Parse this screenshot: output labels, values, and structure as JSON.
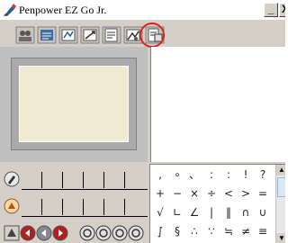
{
  "window": {
    "title": "Penpower EZ Go Jr.",
    "minimize_label": "_",
    "close_label": "X"
  },
  "toolbar": {
    "tools": [
      {
        "name": "user-settings-icon"
      },
      {
        "name": "keyboard-dictionary-icon"
      },
      {
        "name": "handwriting-mode-icon"
      },
      {
        "name": "recognition-mode-icon"
      },
      {
        "name": "document-edit-icon"
      },
      {
        "name": "image-tool-icon"
      },
      {
        "name": "scan-tool-icon",
        "highlighted": true
      }
    ],
    "highlight_color": "#e02020"
  },
  "candidates": {
    "row1_icon": "pen-candidate-icon",
    "row2_icon": "color-candidate-icon",
    "slots_per_row": 6
  },
  "nav_buttons": [
    "pen-color-icon",
    "first-page-icon",
    "prev-page-icon",
    "next-page-icon",
    "circle-1-icon",
    "circle-2-icon",
    "circle-3-icon",
    "circle-4-icon"
  ],
  "symbols": {
    "rows": [
      [
        ",",
        "∘",
        "、",
        ":",
        ":",
        "!",
        "?"
      ],
      [
        "+",
        "−",
        "×",
        "÷",
        "<",
        ">",
        "="
      ],
      [
        "√",
        "∟",
        "∠",
        "|",
        "‖",
        "∩",
        "∪"
      ],
      [
        "∫",
        "§",
        "∴",
        "∵",
        "≒",
        "≠",
        "≡"
      ]
    ]
  },
  "colors": {
    "window_bg": "#d4d0c8",
    "pad_bg": "#f0ead2",
    "pane_bg": "#c0c0c0"
  }
}
